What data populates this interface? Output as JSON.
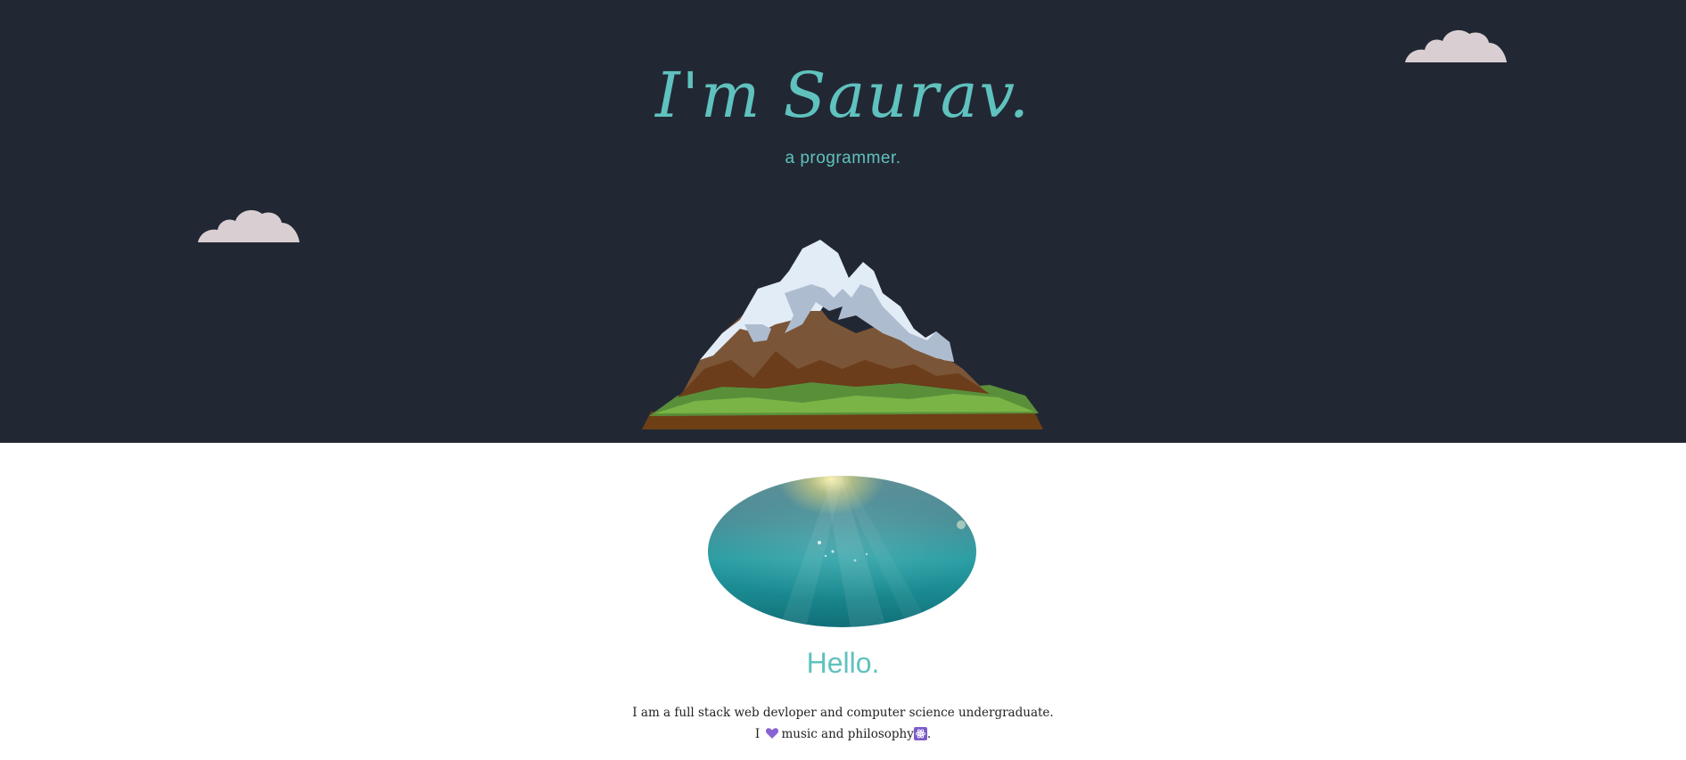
{
  "hero": {
    "title": "I'm Saurav.",
    "subtitle": "a programmer."
  },
  "about": {
    "heading": "Hello.",
    "line1": "I am a full stack web devloper and computer science undergraduate.",
    "line2_prefix": "I",
    "line2_middle": "music and philosophy",
    "line2_suffix": "."
  },
  "colors": {
    "hero_background": "#222833",
    "accent": "#5fc2be",
    "cloud": "#d9cfd3",
    "heart": "#8a63d2"
  },
  "icons": [
    "cloud-icon",
    "mountain-illustration",
    "heart-icon",
    "atom-icon"
  ]
}
